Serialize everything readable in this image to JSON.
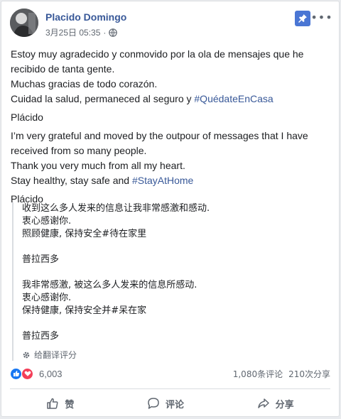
{
  "post": {
    "author": "Placido Domingo",
    "timestamp": "3月25日 05:35",
    "separator": "·",
    "icons": {
      "privacy": "globe-icon",
      "pin": "pin-icon",
      "more": "more-options-icon"
    }
  },
  "content": {
    "spanish_line1": "Estoy muy agradecido y conmovido por la ola de mensajes que he recibido de tanta gente.",
    "spanish_line2": "Muchas gracias de todo corazón.",
    "spanish_line3_prefix": "Cuidad la salud, permaneced al seguro y ",
    "spanish_hashtag": "#QuédateEnCasa",
    "spanish_sign": "Plácido",
    "english_line1": "I’m very grateful and moved by the outpour of messages that I have received from so many people.",
    "english_line2": "Thank you very much from all my heart.",
    "english_line3_prefix": "Stay healthy, stay safe and ",
    "english_hashtag": "#StayAtHome",
    "english_sign": "Plácido"
  },
  "translation": {
    "lines_a": [
      "收到这么多人发来的信息让我非常感激和感动.",
      "衷心感谢你.",
      "照顾健康, 保持安全#待在家里"
    ],
    "sign_a": "普拉西多",
    "lines_b": [
      "我非常感激, 被这么多人发来的信息所感动.",
      "衷心感谢你.",
      "保持健康, 保持安全并#呆在家"
    ],
    "sign_b": "普拉西多",
    "rate_label": "给翻译评分",
    "rate_icon": "gear-icon"
  },
  "stats": {
    "reaction_count": "6,003",
    "comments": "1,080条评论",
    "shares": "210次分享",
    "reaction_icons": [
      "like-icon",
      "love-icon"
    ]
  },
  "actions": {
    "like": "赞",
    "comment": "评论",
    "share": "分享"
  },
  "colors": {
    "link": "#385898",
    "pin_bg": "#4a76d4",
    "like": "#1877f2",
    "love": "#f33e58",
    "meta": "#606770"
  }
}
